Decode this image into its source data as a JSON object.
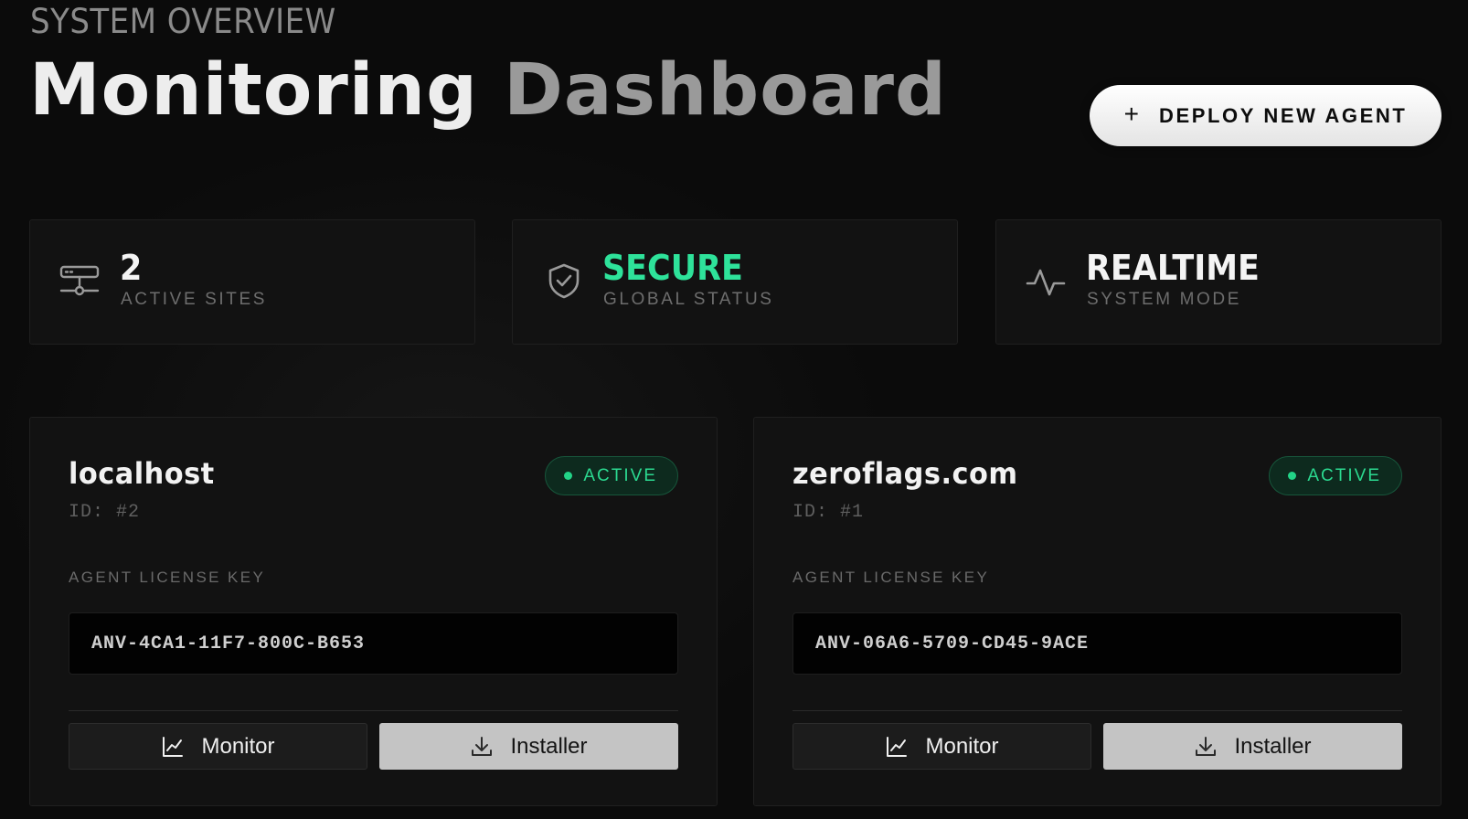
{
  "header": {
    "eyebrow": "SYSTEM OVERVIEW",
    "title_part1": "Monitoring",
    "title_part2": "Dashboard",
    "deploy_button": {
      "icon": "plus-icon",
      "label": "DEPLOY NEW AGENT"
    }
  },
  "stats": [
    {
      "icon": "server-network-icon",
      "value": "2",
      "label": "ACTIVE SITES",
      "value_color": "#f4f4f4"
    },
    {
      "icon": "shield-check-icon",
      "value": "SECURE",
      "label": "GLOBAL STATUS",
      "value_color": "#2ee29a"
    },
    {
      "icon": "activity-pulse-icon",
      "value": "REALTIME",
      "label": "SYSTEM MODE",
      "value_color": "#f4f4f4"
    }
  ],
  "sites": [
    {
      "name": "localhost",
      "id_text": "ID: #2",
      "status": "ACTIVE",
      "license_label": "AGENT LICENSE KEY",
      "license_key": "ANV-4CA1-11F7-800C-B653",
      "monitor_label": "Monitor",
      "installer_label": "Installer"
    },
    {
      "name": "zeroflags.com",
      "id_text": "ID: #1",
      "status": "ACTIVE",
      "license_label": "AGENT LICENSE KEY",
      "license_key": "ANV-06A6-5709-CD45-9ACE",
      "monitor_label": "Monitor",
      "installer_label": "Installer"
    }
  ],
  "colors": {
    "background": "#0b0b0b",
    "card": "#121212",
    "accent_green": "#2ee29a",
    "badge_bg": "#0d2a1e"
  }
}
